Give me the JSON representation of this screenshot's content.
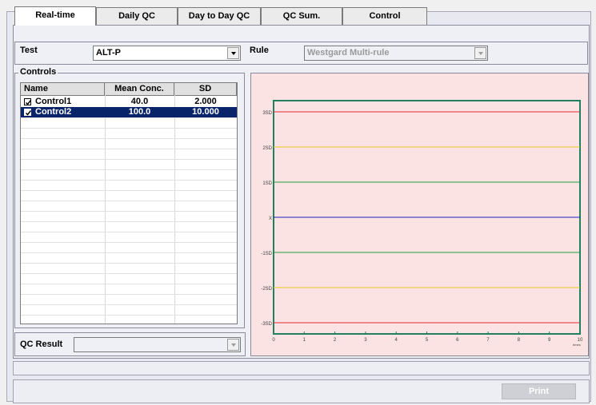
{
  "tabs": [
    {
      "label": "Real-time",
      "active": true
    },
    {
      "label": "Daily QC",
      "active": false
    },
    {
      "label": "Day to Day QC",
      "active": false
    },
    {
      "label": "QC Sum.",
      "active": false
    },
    {
      "label": "Control",
      "active": false
    }
  ],
  "test": {
    "label": "Test",
    "value": "ALT-P"
  },
  "rule": {
    "label": "Rule",
    "value": "Westgard Multi-rule"
  },
  "controls": {
    "legend": "Controls",
    "columns": [
      "Name",
      "Mean Conc.",
      "SD"
    ],
    "rows": [
      {
        "name": "Control1",
        "mean": "40.0",
        "sd": "2.000",
        "checked": true,
        "selected": false
      },
      {
        "name": "Control2",
        "mean": "100.0",
        "sd": "10.000",
        "checked": true,
        "selected": true
      }
    ]
  },
  "qc_result": {
    "label": "QC Result",
    "value": ""
  },
  "print_label": "Print",
  "chart_data": {
    "type": "line",
    "y_levels": [
      "3SD",
      "2SD",
      "1SD",
      "X",
      "-1SD",
      "-2SD",
      "-3SD"
    ],
    "y_level_colors": [
      "#e03030",
      "#e8c820",
      "#20a040",
      "#2020c0",
      "#20a040",
      "#e8c820",
      "#e03030"
    ],
    "x_ticks": [
      "0",
      "1",
      "2",
      "3",
      "4",
      "5",
      "6",
      "7",
      "8",
      "9",
      "10"
    ],
    "x_unit": "times",
    "xlim": [
      0,
      10
    ],
    "series": [],
    "frame_color": "#208060",
    "background": "#fbe3e3"
  }
}
